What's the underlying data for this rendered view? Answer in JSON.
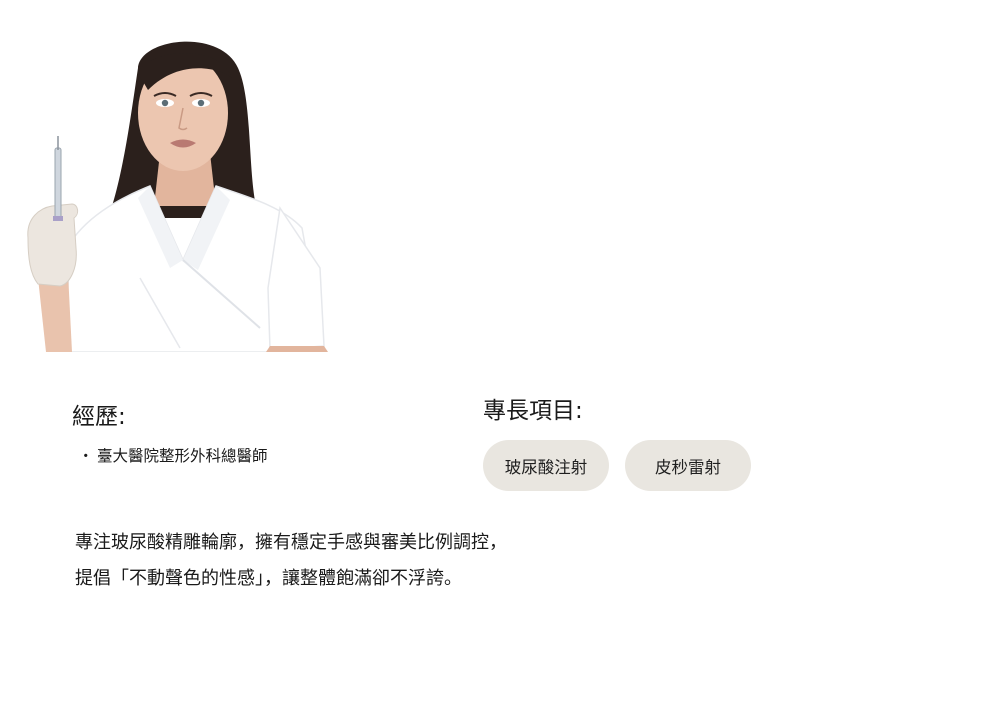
{
  "portrait": {
    "icon": "doctor-portrait-icon"
  },
  "experience": {
    "heading": "經歷:",
    "items": [
      "臺大醫院整形外科總醫師"
    ]
  },
  "specialties": {
    "heading": "專長項目:",
    "tags": [
      "玻尿酸注射",
      "皮秒雷射"
    ]
  },
  "description": {
    "line1": "專注玻尿酸精雕輪廓，擁有穩定手感與審美比例調控，",
    "line2": "提倡「不動聲色的性感」，讓整體飽滿卻不浮誇。"
  },
  "colors": {
    "tag_bg": "#e9e6e0",
    "text": "#1a1a1a",
    "uniform": "#ffffff",
    "hair": "#2b201c",
    "skin": "#e9c3ad",
    "glove": "#ece6df"
  }
}
